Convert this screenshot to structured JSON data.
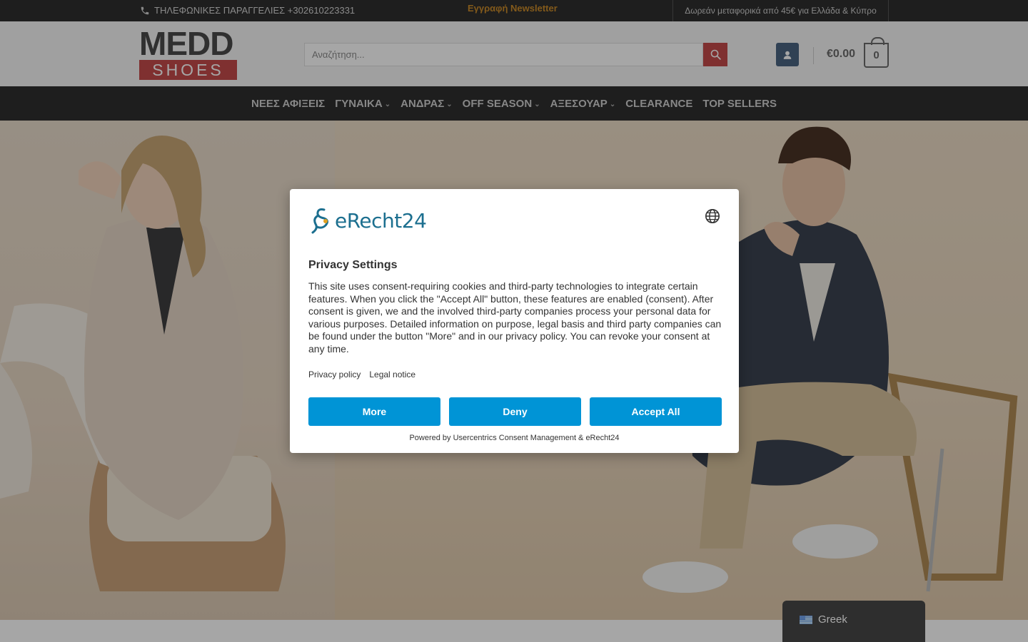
{
  "topbar": {
    "phone_text": "ΤΗΛΕΦΩΝΙΚΕΣ ΠΑΡΑΓΓΕΛΙΕΣ +302610223331",
    "newsletter": "Εγγραφή Newsletter",
    "shipping": "Δωρεάν μεταφορικά από 45€ για Ελλάδα & Κύπρο"
  },
  "header": {
    "logo_top": "MEDD",
    "logo_bottom": "SHOES",
    "search_placeholder": "Αναζήτηση...",
    "cart_total": "€0.00",
    "cart_count": "0"
  },
  "nav": {
    "items": [
      {
        "label": "ΝΕΕΣ ΑΦΙΞΕΙΣ",
        "has_dropdown": false
      },
      {
        "label": "ΓΥΝΑΙΚΑ",
        "has_dropdown": true
      },
      {
        "label": "ΑΝΔΡΑΣ",
        "has_dropdown": true
      },
      {
        "label": "OFF SEASON",
        "has_dropdown": true
      },
      {
        "label": "ΑΞΕΣΟΥΑΡ",
        "has_dropdown": true
      },
      {
        "label": "CLEARANCE",
        "has_dropdown": false
      },
      {
        "label": "TOP SELLERS",
        "has_dropdown": false
      }
    ]
  },
  "modal": {
    "brand": "eRecht24",
    "title": "Privacy Settings",
    "body": "This site uses consent-requiring cookies and third-party technologies to integrate certain features. When you click the \"Accept All\" button, these features are enabled (consent). After consent is given, we and the involved third-party companies process your personal data for various purposes. Detailed information on purpose, legal basis and third party companies can be found under the button \"More\" and in our privacy policy. You can revoke your consent at any time.",
    "links": {
      "privacy": "Privacy policy",
      "legal": "Legal notice"
    },
    "buttons": {
      "more": "More",
      "deny": "Deny",
      "accept": "Accept All"
    },
    "powered": "Powered by Usercentrics Consent Management & eRecht24"
  },
  "language": {
    "current": "Greek"
  },
  "colors": {
    "accent": "#c44a4a",
    "consent_button": "#0094d6",
    "dark_bar": "#2e2e2e",
    "newsletter": "#c98a2a"
  }
}
